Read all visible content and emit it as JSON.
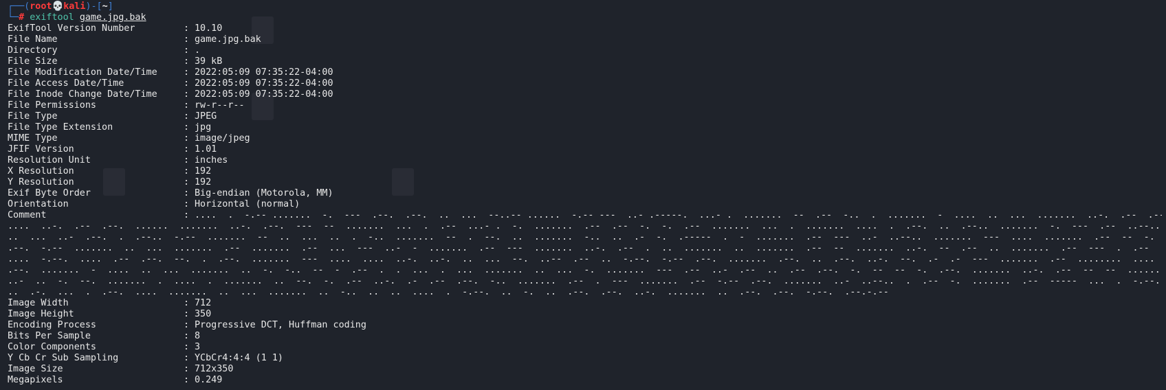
{
  "prompt": {
    "box_open": "┌──(",
    "user": "root",
    "skull": "💀",
    "host": "kali",
    "box_mid": ")-[",
    "cwd": "~",
    "box_close": "]",
    "box_bottom": "└─",
    "hash": "#",
    "command": "exiftool",
    "argument": "game.jpg.bak"
  },
  "fields_top": [
    {
      "key": "ExifTool Version Number",
      "value": "10.10"
    },
    {
      "key": "File Name",
      "value": "game.jpg.bak"
    },
    {
      "key": "Directory",
      "value": "."
    },
    {
      "key": "File Size",
      "value": "39 kB"
    },
    {
      "key": "File Modification Date/Time",
      "value": "2022:05:09 07:35:22-04:00"
    },
    {
      "key": "File Access Date/Time",
      "value": "2022:05:09 07:35:22-04:00"
    },
    {
      "key": "File Inode Change Date/Time",
      "value": "2022:05:09 07:35:22-04:00"
    },
    {
      "key": "File Permissions",
      "value": "rw-r--r--"
    },
    {
      "key": "File Type",
      "value": "JPEG"
    },
    {
      "key": "File Type Extension",
      "value": "jpg"
    },
    {
      "key": "MIME Type",
      "value": "image/jpeg"
    },
    {
      "key": "JFIF Version",
      "value": "1.01"
    },
    {
      "key": "Resolution Unit",
      "value": "inches"
    },
    {
      "key": "X Resolution",
      "value": "192"
    },
    {
      "key": "Y Resolution",
      "value": "192"
    },
    {
      "key": "Exif Byte Order",
      "value": "Big-endian (Motorola, MM)"
    },
    {
      "key": "Orientation",
      "value": "Horizontal (normal)"
    }
  ],
  "comment": {
    "key": "Comment",
    "separator": ":",
    "first": "....  .  -.-- .......  -.  ---  .--.  .--.  ..  ...  --..-- ......  -.-- ---  ..- .-----.  ...- .  .......  --  .--  -..  .  .......  -  ....  ..  ...  .......  ..-.  .--  .--.  .--.-.--  .......  ..-.  .--  .--.  ....",
    "lines": [
      "....  ..-.  .--  .--.  ......  .......  ..-.  .--.  ---  --  .......  ...  .  .--  ...- .  -.  .......  .--  .--  -.  -.  .--  .......  ...  .  .......  ....  .  .--.  ..  .--..  .......  -.  ---  .--  ..--..  .......  ...  .--  ....  .--  .......  -.--  ---  ..-  .....",
      "..  ...  ..-  .--.  .  .--..  -.--  .......  --  ..  ...  ..  .  -..  .......  --  .  --.  ..  .......  -..  ..  .-  -.  .-----  .  -  .......  .--  ---  ..-  ..--..  .......  ---  ....  .......  .--  --  -.  .......  --  -.--  .......  -...  .--  --  .  .",
      ".--.  -.--  .......  ..  ...  .......  .--  .......  .--  ...  ---  ..-  -  .......  .--  ---  .......  ..-.  .--  .  ..  .......  ..  .......  .--  --  .......  ..-.  --  .--  ..  .......  .--  ---  .  .--  -.  ..  .......  ..-  .......  ---  .  .--  .......  -.-.  -.--  ...",
      "....  -.--.  ....  .--  .--.  --.  .  .--.  .......  ---  ....  ....  ..-.  ..-.  ..  ...  --.  ..--  .--  ..  -.--.  -.--  .--.  .......  .--.  ..  .--.  ..-.  --.  .-  .-  ---  .......  .--  ........  ....  ..  -.  -.  .......  ..  -.  .......  ....  .--.  ..--.  ..-.  ---",
      ".--.  .......  -  ....  ..  ...  .......  ..  -.  -..  --  -  .--  .  .  ...  .  ...  .......  ..  ...  -.  .......  ---  .--  ..-  .--  ..  .--  .--.  -.  --  --  -.  .--.  .......  ..-.  .--  --  --  .......  ...  ..  .--  ....  .  .--.  -  .-  ..  .--  .--.  .--  .-",
      "..-  ..  -.  --.  .......  .  ....  .  .......  ..  --.  -.  .--  ..-.  .-  .--  .--.  -..  .......  .--  .  ---  .......  .--  -.--  .--.  .......  ..-  ..--..  .  .--  -.  .......  .--  -----  ...  .  -.--.  .--.  .  -.  ..-.  ..--  .......  ..  ..  .--.  .--.  ---",
      "..  .-.  ...  .  .--.  ....  .......  ..  ...  .......  ..  -..  ..  ..  ....  .  -.--.  ..  -.  ..  .--.  .--.  ..-.  .......  ..  .--.  .--.  -.--.  .--.-.--",
      ""
    ]
  },
  "fields_bottom": [
    {
      "key": "Image Width",
      "value": "712"
    },
    {
      "key": "Image Height",
      "value": "350"
    },
    {
      "key": "Encoding Process",
      "value": "Progressive DCT, Huffman coding"
    },
    {
      "key": "Bits Per Sample",
      "value": "8"
    },
    {
      "key": "Color Components",
      "value": "3"
    },
    {
      "key": "Y Cb Cr Sub Sampling",
      "value": "YCbCr4:4:4 (1 1)"
    },
    {
      "key": "Image Size",
      "value": "712x350"
    },
    {
      "key": "Megapixels",
      "value": "0.249"
    }
  ],
  "separator": ":",
  "colors": {
    "background": "#1f232b",
    "prompt_box": "#3f7fd4",
    "prompt_user": "#ff3b3b",
    "command": "#4fc3a9",
    "text": "#e8e8e8"
  }
}
